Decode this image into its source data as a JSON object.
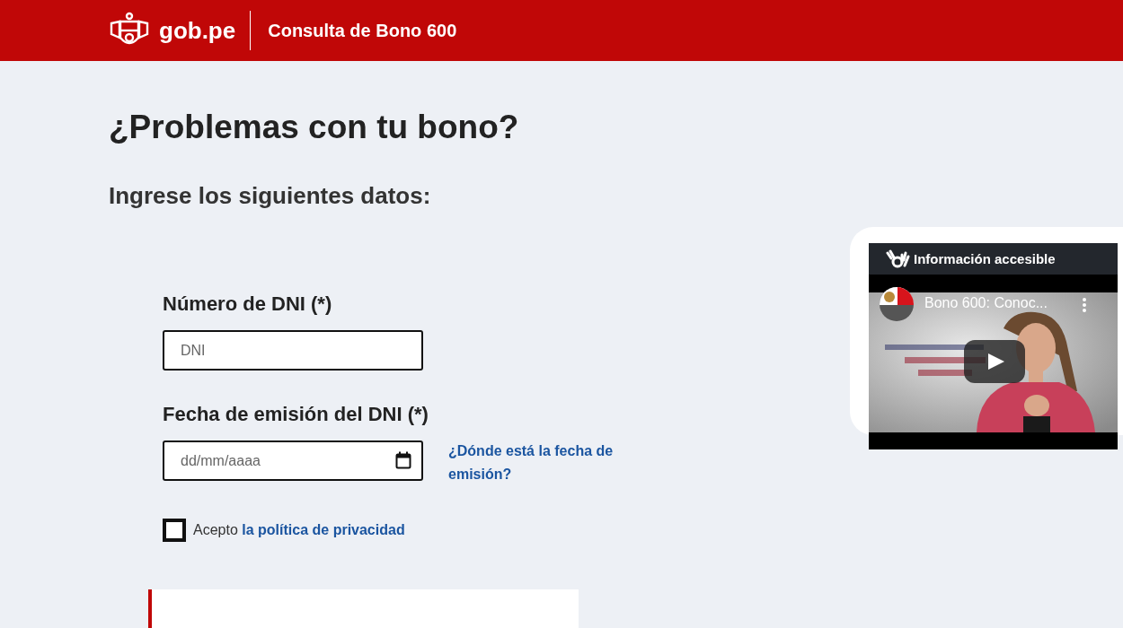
{
  "header": {
    "logo_text": "gob.pe",
    "title": "Consulta de Bono 600"
  },
  "page_title": "¿Problemas con tu bono?",
  "subtitle": "Ingrese los siguientes datos:",
  "fields": [
    {
      "kind": "text",
      "label": "Número de DNI (*)",
      "placeholder": "DNI"
    },
    {
      "kind": "date",
      "label": "Fecha de emisión del DNI (*)",
      "placeholder": "dd/mm/aaaa",
      "help_link": "¿Dónde está la fecha de emisión?"
    }
  ],
  "consent": {
    "checked": false,
    "text": "Acepto",
    "link": "la política de privacidad"
  },
  "accessible_widget": {
    "title": "Información accesible",
    "video": {
      "title": "Bono 600: Conoc..."
    }
  }
}
